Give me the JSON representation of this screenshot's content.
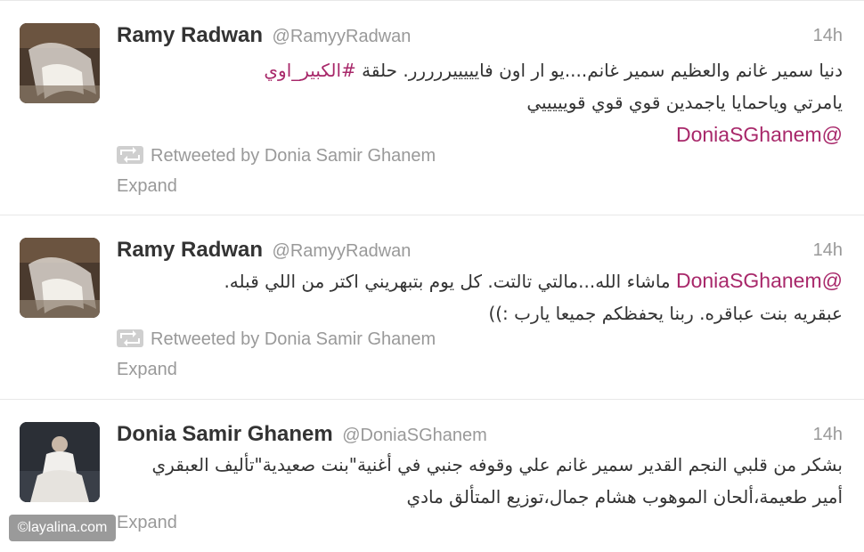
{
  "tweets": [
    {
      "name": "Ramy Radwan",
      "handle": "@RamyyRadwan",
      "time": "14h",
      "line1_text": "دنيا سمير غانم والعظيم سمير غانم....يو ار اون فايييييررررر. حلقة ",
      "line1_hashtag": "#الكبير_اوي",
      "line2_text": "يامرتي وياحمايا ياجمدين قوي قوي قويييييي",
      "line3_mention": "@DoniaSGhanem",
      "retweeted_by": "Retweeted by Donia Samir Ghanem",
      "expand": "Expand"
    },
    {
      "name": "Ramy Radwan",
      "handle": "@RamyyRadwan",
      "time": "14h",
      "line1_mention": "@DoniaSGhanem",
      "line1_text": " ماشاء الله...مالتي تالتت. كل يوم بتبهريني اكتر من اللي قبله.",
      "line2_text": "عبقريه بنت عباقره. ربنا يحفظكم جميعا يارب :))",
      "retweeted_by": "Retweeted by Donia Samir Ghanem",
      "expand": "Expand"
    },
    {
      "name": "Donia Samir Ghanem",
      "handle": "@DoniaSGhanem",
      "time": "14h",
      "line1_text": "بشكر من قلبي النجم القدير سمير غانم علي وقوفه جنبي في أغنية\"بنت صعيدية\"تأليف العبقري",
      "line2_text": "أمير طعيمة،ألحان الموهوب هشام جمال،توزيع المتألق مادي",
      "expand": "Expand"
    }
  ],
  "watermark": "©layalina.com",
  "colors": {
    "link": "#a8286a",
    "muted": "#999999",
    "name": "#333333"
  },
  "icons": {
    "retweet": "retweet-icon"
  }
}
